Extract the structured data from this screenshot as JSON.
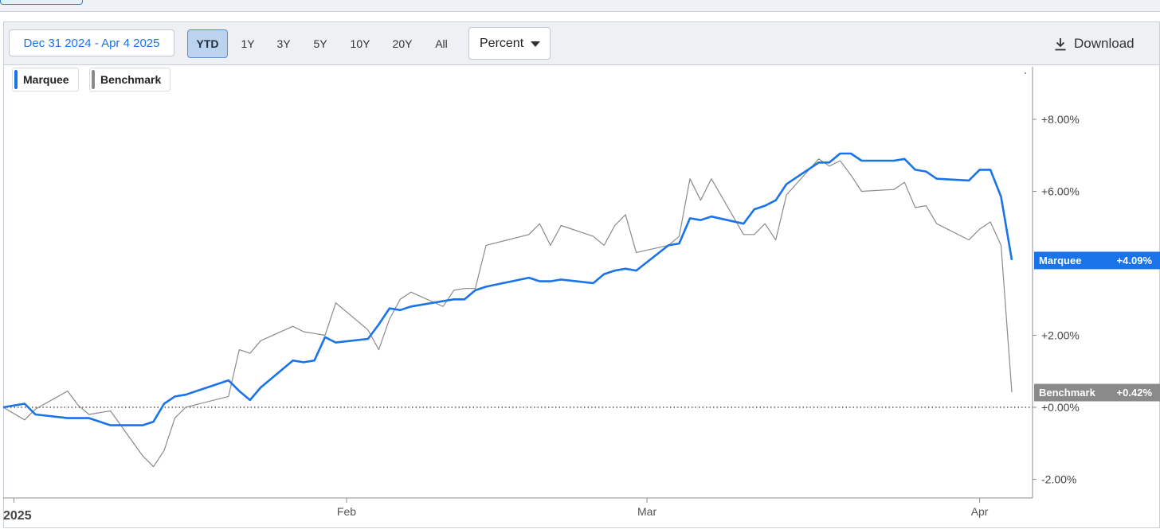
{
  "toolbar": {
    "date_range": "Dec 31 2024 - Apr 4 2025",
    "ranges": [
      "YTD",
      "1Y",
      "3Y",
      "5Y",
      "10Y",
      "20Y",
      "All"
    ],
    "active_range": "YTD",
    "unit": "Percent",
    "download_label": "Download"
  },
  "colors": {
    "marquee": "#1a73e8",
    "benchmark": "#8a8a8a",
    "accent": "#1a73e8"
  },
  "chart_data": {
    "type": "line",
    "title": "",
    "xlabel": "",
    "ylabel": "",
    "ylim": [
      -2.6,
      9.4
    ],
    "yticks": [
      -2,
      0,
      2,
      6,
      8
    ],
    "ytick_labels": [
      "-2.00%",
      "+0.00%",
      "+2.00%",
      "+6.00%",
      "+8.00%"
    ],
    "xticks": [
      {
        "date": "2025-01-01",
        "label": "2025"
      },
      {
        "date": "2025-02-01",
        "label": "Feb"
      },
      {
        "date": "2025-03-01",
        "label": "Mar"
      },
      {
        "date": "2025-04-01",
        "label": "Apr"
      }
    ],
    "x": [
      "2024-12-31",
      "2025-01-02",
      "2025-01-03",
      "2025-01-06",
      "2025-01-07",
      "2025-01-08",
      "2025-01-10",
      "2025-01-13",
      "2025-01-14",
      "2025-01-15",
      "2025-01-16",
      "2025-01-17",
      "2025-01-21",
      "2025-01-22",
      "2025-01-23",
      "2025-01-24",
      "2025-01-27",
      "2025-01-28",
      "2025-01-29",
      "2025-01-30",
      "2025-01-31",
      "2025-02-03",
      "2025-02-04",
      "2025-02-05",
      "2025-02-06",
      "2025-02-07",
      "2025-02-10",
      "2025-02-11",
      "2025-02-12",
      "2025-02-13",
      "2025-02-14",
      "2025-02-18",
      "2025-02-19",
      "2025-02-20",
      "2025-02-21",
      "2025-02-24",
      "2025-02-25",
      "2025-02-26",
      "2025-02-27",
      "2025-02-28",
      "2025-03-03",
      "2025-03-04",
      "2025-03-05",
      "2025-03-06",
      "2025-03-07",
      "2025-03-10",
      "2025-03-11",
      "2025-03-12",
      "2025-03-13",
      "2025-03-14",
      "2025-03-17",
      "2025-03-18",
      "2025-03-19",
      "2025-03-20",
      "2025-03-21",
      "2025-03-24",
      "2025-03-25",
      "2025-03-26",
      "2025-03-27",
      "2025-03-28",
      "2025-03-31",
      "2025-04-01",
      "2025-04-02",
      "2025-04-03",
      "2025-04-04"
    ],
    "series": [
      {
        "name": "Marquee",
        "color": "#1a73e8",
        "last_label": "+4.09%",
        "values": [
          0.0,
          0.1,
          -0.2,
          -0.3,
          -0.3,
          -0.3,
          -0.5,
          -0.5,
          -0.4,
          0.1,
          0.3,
          0.35,
          0.75,
          0.45,
          0.2,
          0.55,
          1.3,
          1.25,
          1.3,
          1.95,
          1.8,
          1.9,
          2.3,
          2.75,
          2.7,
          2.8,
          2.95,
          3.0,
          3.0,
          3.25,
          3.35,
          3.6,
          3.5,
          3.5,
          3.55,
          3.45,
          3.7,
          3.8,
          3.85,
          3.8,
          4.5,
          4.55,
          5.25,
          5.2,
          5.3,
          5.1,
          5.5,
          5.6,
          5.75,
          6.2,
          6.8,
          6.8,
          7.05,
          7.05,
          6.85,
          6.85,
          6.9,
          6.6,
          6.55,
          6.35,
          6.3,
          6.6,
          6.6,
          5.85,
          4.09
        ]
      },
      {
        "name": "Benchmark",
        "color": "#8a8a8a",
        "last_label": "+0.42%",
        "values": [
          0.0,
          -0.35,
          -0.05,
          0.45,
          0.05,
          -0.2,
          -0.1,
          -1.35,
          -1.65,
          -1.2,
          -0.3,
          0.0,
          0.3,
          1.6,
          1.5,
          1.85,
          2.25,
          2.1,
          2.05,
          2.0,
          2.9,
          2.15,
          1.6,
          2.45,
          3.0,
          3.2,
          2.8,
          3.25,
          3.3,
          3.3,
          4.5,
          4.8,
          5.1,
          4.5,
          5.05,
          4.75,
          4.5,
          5.05,
          5.35,
          4.3,
          4.5,
          4.75,
          6.35,
          5.75,
          6.35,
          4.8,
          4.8,
          5.1,
          4.65,
          5.9,
          6.9,
          6.7,
          6.85,
          6.45,
          6.0,
          6.05,
          6.25,
          5.55,
          5.6,
          5.1,
          4.65,
          4.95,
          5.15,
          4.5,
          0.42
        ]
      }
    ],
    "legend": [
      "Marquee",
      "Benchmark"
    ],
    "legend_position": "top-left",
    "grid": false,
    "zero_line": "dotted"
  }
}
